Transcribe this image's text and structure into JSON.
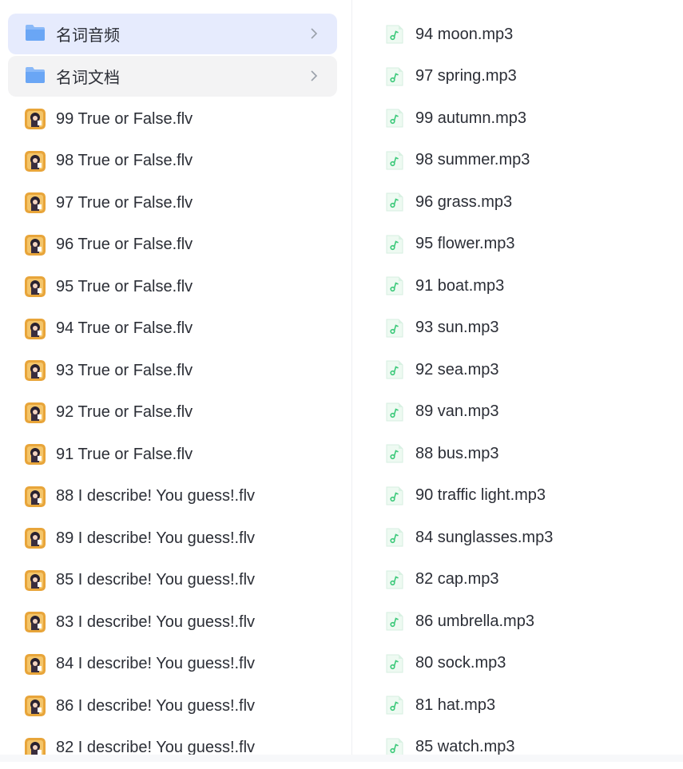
{
  "colors": {
    "selected_bg": "#e6ebfd",
    "hover_bg": "#f3f3f4",
    "audio_accent": "#3cc97a",
    "folder_blue": "#7fb2f7",
    "text": "#2b2e36"
  },
  "folders": [
    {
      "label": "名词音频",
      "icon": "folder-icon",
      "state": "selected"
    },
    {
      "label": "名词文档",
      "icon": "folder-icon",
      "state": "hovered"
    }
  ],
  "video_files": [
    "99 True or False.flv",
    "98 True or False.flv",
    "97 True or False.flv",
    "96 True or False.flv",
    "95 True or False.flv",
    "94 True or False.flv",
    "93 True or False.flv",
    "92 True or False.flv",
    "91 True or False.flv",
    "88 I describe! You guess!.flv",
    "89 I describe! You guess!.flv",
    "85 I describe! You guess!.flv",
    "83 I describe! You guess!.flv",
    "84 I describe! You guess!.flv",
    "86 I describe! You guess!.flv",
    "82 I describe! You guess!.flv"
  ],
  "audio_files": [
    "94 moon.mp3",
    "97 spring.mp3",
    "99 autumn.mp3",
    "98 summer.mp3",
    "96 grass.mp3",
    "95 flower.mp3",
    "91 boat.mp3",
    "93 sun.mp3",
    "92 sea.mp3",
    "89 van.mp3",
    "88 bus.mp3",
    "90 traffic light.mp3",
    "84 sunglasses.mp3",
    "82 cap.mp3",
    "86 umbrella.mp3",
    "80 sock.mp3",
    "81 hat.mp3",
    "85 watch.mp3"
  ]
}
